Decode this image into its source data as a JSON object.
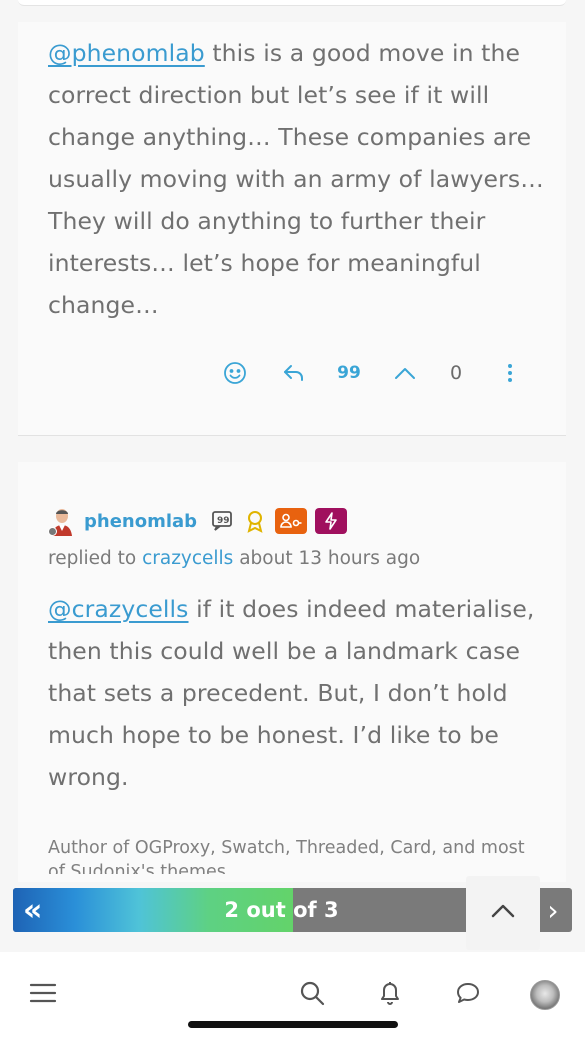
{
  "posts": [
    {
      "mention": "@phenomlab",
      "body": " this is a good move in the correct direction but let’s see if it will change anything… These companies are usually moving with an army of lawyers… They will do anything to further their interests… let’s hope for meaningful change…",
      "actions": {
        "upvote_count": "0",
        "quote_glyph": "99"
      }
    },
    {
      "author": "phenomlab",
      "reply_prefix": "replied to ",
      "reply_target": "crazycells",
      "reply_time": " about 13 hours ago",
      "mention": "@crazycells",
      "body": " if it does indeed materialise, then this could well be a landmark case that sets a precedent. But, I don’t hold much hope to be honest. I’d like to be wrong.",
      "signature": "Author of OGProxy, Swatch, Threaded, Card, and most",
      "signature_clip": "of Sudonix's themes",
      "badges": [
        {
          "icon": "quote-badge-icon",
          "color": "#555555"
        },
        {
          "icon": "award-badge-icon",
          "color": "#e0b400"
        },
        {
          "icon": "user-key-badge-icon",
          "color": "#e8620f"
        },
        {
          "icon": "bolt-badge-icon",
          "color": "#a0105e"
        }
      ]
    }
  ],
  "navigator": {
    "label": "2 out of 3",
    "progress_fraction": 0.5,
    "first_glyph": "«",
    "next_glyph": "›"
  },
  "colors": {
    "link": "#3a9bd0",
    "action_icon": "#3aa5d6",
    "progress_start": "#1e63b5",
    "progress_end": "#63d36a"
  },
  "bottom_nav": [
    "menu-icon",
    "search-icon",
    "bell-icon",
    "chat-icon",
    "user-avatar"
  ]
}
